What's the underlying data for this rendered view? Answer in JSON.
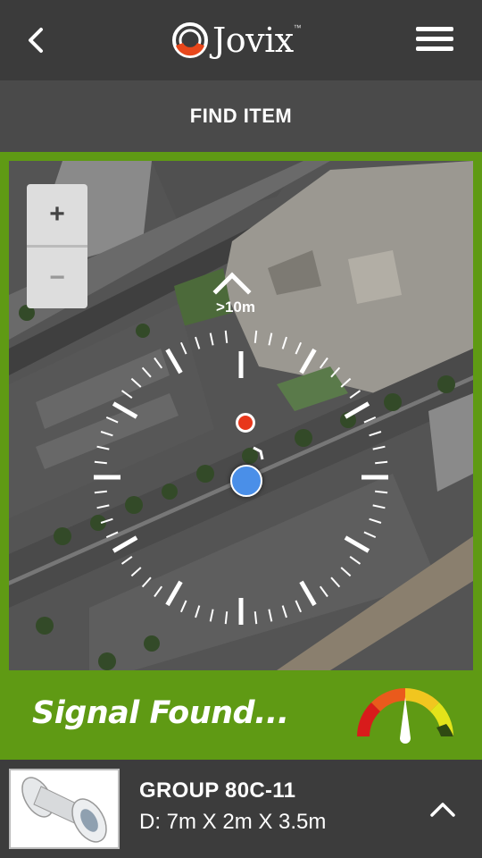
{
  "header": {
    "logo_text": "Jovix",
    "logo_tm": "™",
    "back_icon": "chevron-left-icon",
    "menu_icon": "hamburger-menu-icon"
  },
  "subheader": {
    "title": "FIND ITEM"
  },
  "map": {
    "zoom_in_label": "+",
    "zoom_out_label": "−",
    "range_label": ">10m",
    "target_color": "#e8371b",
    "user_color": "#4a8fe8"
  },
  "signal": {
    "status_text": "Signal Found...",
    "gauge_level": 0.5
  },
  "item": {
    "title": "GROUP 80C-11",
    "dimensions": "D: 7m X 2m X 3.5m",
    "thumbnail": "pipe-spool-image",
    "expand_icon": "chevron-up-icon"
  },
  "colors": {
    "accent_green": "#5f9a14",
    "header_bg": "#3b3b3b"
  }
}
